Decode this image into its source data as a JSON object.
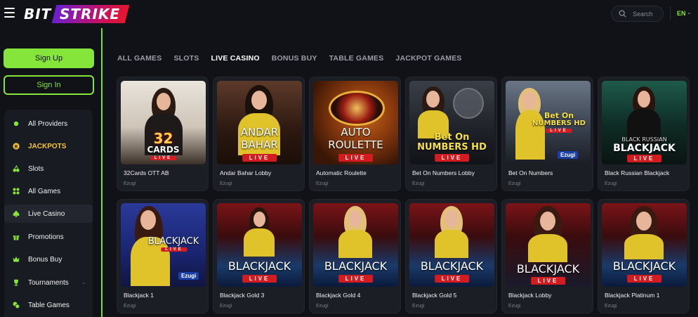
{
  "brand": {
    "part1": "BIT",
    "part2": "STRIKE"
  },
  "header": {
    "search_label": "Search",
    "language": "EN"
  },
  "auth": {
    "signup": "Sign Up",
    "signin": "Sign In"
  },
  "menu": [
    {
      "label": "All Providers",
      "icon": "dot-icon"
    },
    {
      "label": "JACKPOTS",
      "icon": "coin-icon"
    },
    {
      "label": "Slots",
      "icon": "cherry-icon"
    },
    {
      "label": "All Games",
      "icon": "grid-icon"
    },
    {
      "label": "Live Casino",
      "icon": "spade-icon"
    },
    {
      "label": "Promotions",
      "icon": "gift-icon"
    },
    {
      "label": "Bonus Buy",
      "icon": "crown-icon"
    },
    {
      "label": "Tournaments",
      "icon": "trophy-icon"
    },
    {
      "label": "Table Games",
      "icon": "chips-icon"
    }
  ],
  "tabs": [
    "ALL GAMES",
    "SLOTS",
    "LIVE CASINO",
    "BONUS BUY",
    "TABLE GAMES",
    "JACKPOT GAMES"
  ],
  "active_tab": "LIVE CASINO",
  "games": [
    {
      "title": "32Cards OTT AB",
      "provider": "Ezugi",
      "art": "32",
      "art_sub": "CARDS",
      "live": "LIVE"
    },
    {
      "title": "Andar Bahar Lobby",
      "provider": "Ezugi",
      "art": "ANDAR",
      "art_sub": "BAHAR",
      "live": "LIVE"
    },
    {
      "title": "Automatic Roulette",
      "provider": "Ezugi",
      "art": "AUTO",
      "art_sub": "ROULETTE",
      "live": "LIVE"
    },
    {
      "title": "Bet On Numbers Lobby",
      "provider": "Ezugi",
      "art": "Bet On",
      "art_sub": "NUMBERS HD",
      "live": "LIVE"
    },
    {
      "title": "Bet On Numbers",
      "provider": "Ezugi",
      "art": "Bet On",
      "art_sub": "NUMBERS HD",
      "live": "LIVE",
      "logo": "Ezugi"
    },
    {
      "title": "Black Russian Blackjack",
      "provider": "Ezugi",
      "art": "BLACK RUSSIAN",
      "art_sub": "BLACKJACK",
      "live": "LIVE"
    },
    {
      "title": "Blackjack 1",
      "provider": "Ezugi",
      "art": "",
      "art_sub": "BLACKJACK",
      "live": "LIVE",
      "logo": "Ezugi"
    },
    {
      "title": "Blackjack Gold 3",
      "provider": "Ezugi",
      "art": "",
      "art_sub": "BLACKJACK",
      "live": "LIVE"
    },
    {
      "title": "Blackjack Gold 4",
      "provider": "Ezugi",
      "art": "",
      "art_sub": "BLACKJACK",
      "live": "LIVE"
    },
    {
      "title": "Blackjack Gold 5",
      "provider": "Ezugi",
      "art": "",
      "art_sub": "BLACKJACK",
      "live": "LIVE"
    },
    {
      "title": "Blackjack Lobby",
      "provider": "Ezugi",
      "art": "",
      "art_sub": "BLACKJACK",
      "live": "LIVE"
    },
    {
      "title": "Blackjack Platinum 1",
      "provider": "Ezugi",
      "art": "",
      "art_sub": "BLACKJACK",
      "live": "LIVE"
    }
  ],
  "colors": {
    "accent": "#86e53b",
    "jackpot": "#f6c33a",
    "live": "#d41b20",
    "background": "#111218"
  }
}
